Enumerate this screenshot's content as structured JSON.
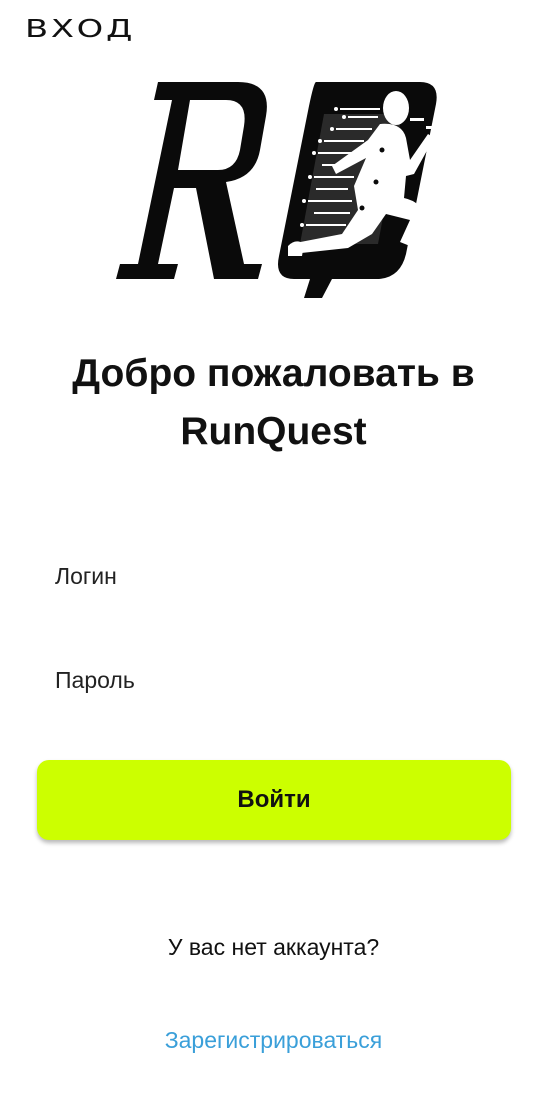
{
  "header": {
    "title": "ВХОД"
  },
  "logo": {
    "letters": "RQ",
    "icon": "runner-logo-icon"
  },
  "welcome": {
    "line1": "Добро пожаловать в",
    "line2": "RunQuest"
  },
  "form": {
    "login_placeholder": "Логин",
    "password_placeholder": "Пароль",
    "submit_label": "Войти"
  },
  "footer": {
    "no_account_text": "У вас нет аккаунта?",
    "register_label": "Зарегистрироваться"
  },
  "colors": {
    "accent": "#ccff00",
    "link": "#3a9fd9",
    "text": "#111111",
    "background": "#ffffff"
  }
}
